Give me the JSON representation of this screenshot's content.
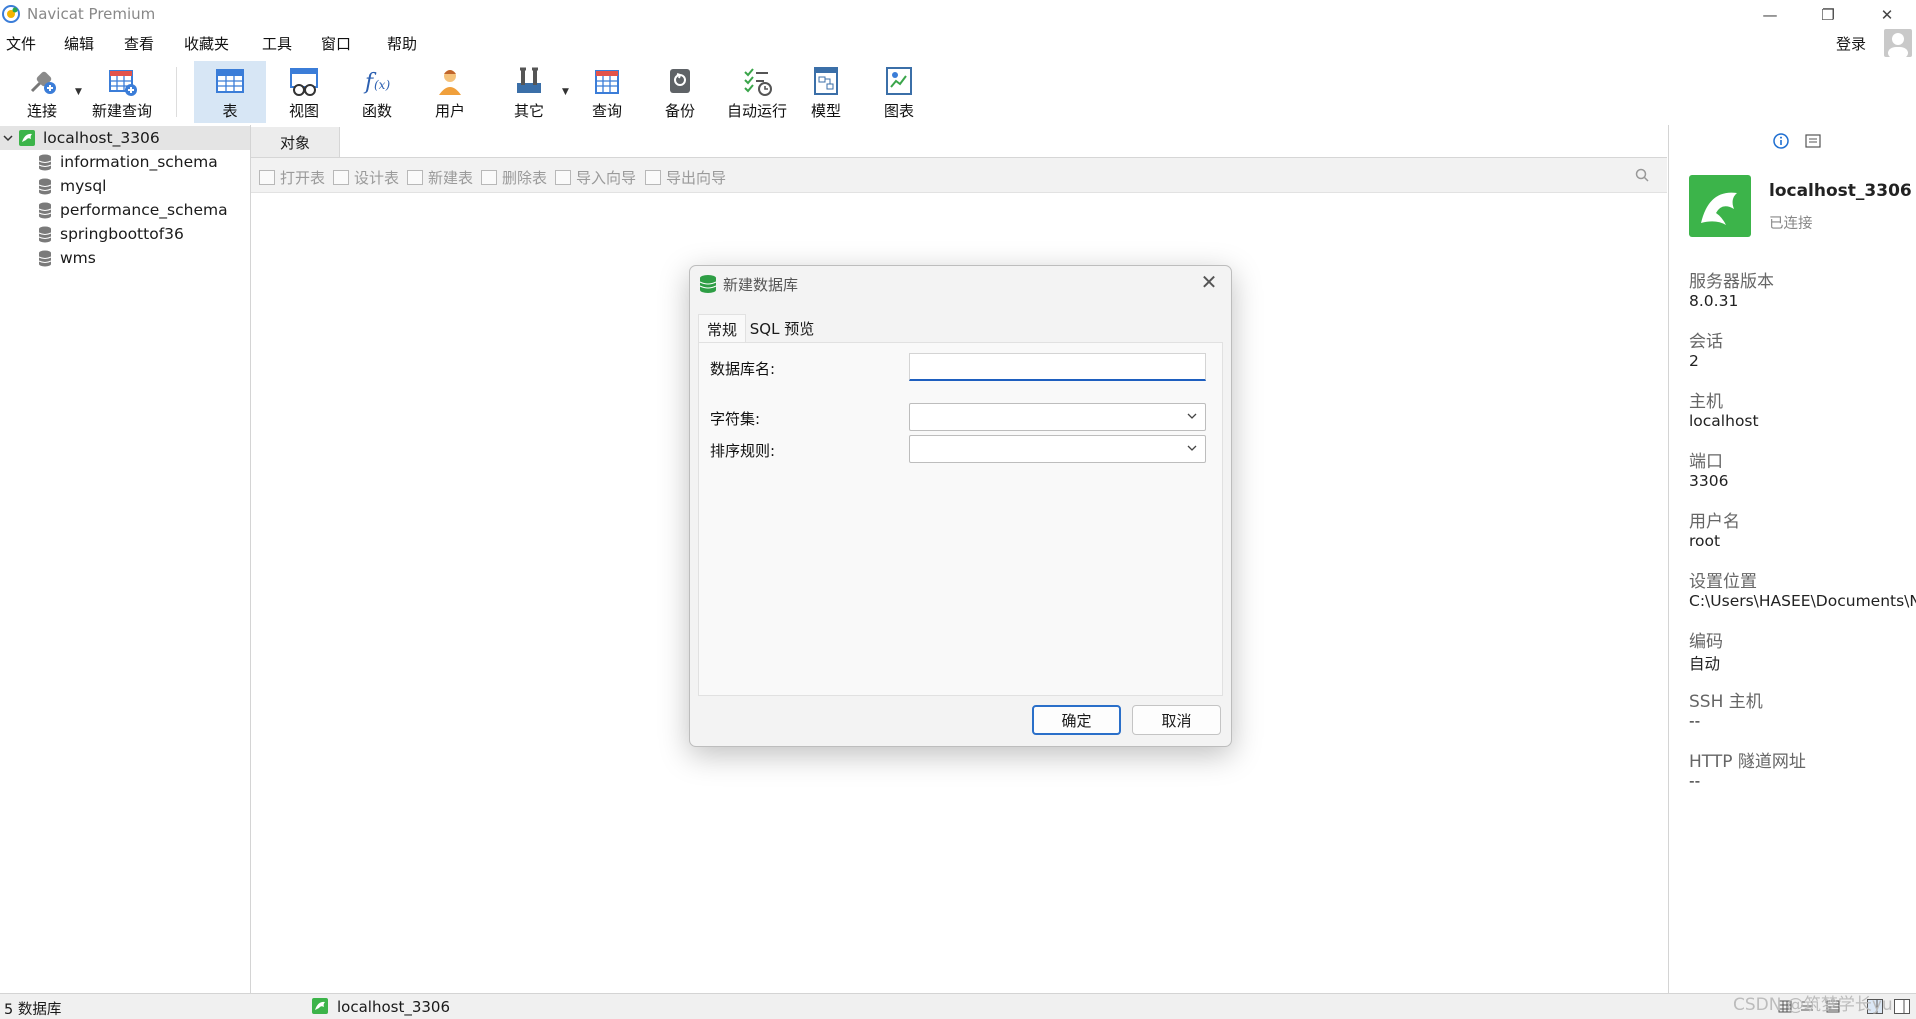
{
  "window": {
    "title": "Navicat Premium",
    "minimize": "—",
    "restore": "❐",
    "close": "✕"
  },
  "menu": {
    "items": [
      "文件",
      "编辑",
      "查看",
      "收藏夹",
      "工具",
      "窗口",
      "帮助"
    ],
    "login": "登录"
  },
  "toolbar": {
    "items": [
      {
        "label": "连接",
        "icon": "connect-plug-icon"
      },
      {
        "label": "新建查询",
        "icon": "new-query-icon"
      },
      {
        "label": "表",
        "icon": "table-icon"
      },
      {
        "label": "视图",
        "icon": "view-icon"
      },
      {
        "label": "函数",
        "icon": "function-icon"
      },
      {
        "label": "用户",
        "icon": "user-icon"
      },
      {
        "label": "其它",
        "icon": "tools-icon"
      },
      {
        "label": "查询",
        "icon": "query-icon"
      },
      {
        "label": "备份",
        "icon": "backup-icon"
      },
      {
        "label": "自动运行",
        "icon": "automation-icon"
      },
      {
        "label": "模型",
        "icon": "model-icon"
      },
      {
        "label": "图表",
        "icon": "chart-icon"
      }
    ],
    "active": "表"
  },
  "tree": {
    "connection": "localhost_3306",
    "databases": [
      "information_schema",
      "mysql",
      "performance_schema",
      "springboottof36",
      "wms"
    ]
  },
  "main": {
    "tab": "对象",
    "object_toolbar": [
      "打开表",
      "设计表",
      "新建表",
      "删除表",
      "导入向导",
      "导出向导"
    ]
  },
  "info_panel": {
    "name": "localhost_3306",
    "status": "已连接",
    "fields": [
      {
        "key": "服务器版本",
        "value": "8.0.31"
      },
      {
        "key": "会话",
        "value": "2"
      },
      {
        "key": "主机",
        "value": "localhost"
      },
      {
        "key": "端口",
        "value": "3306"
      },
      {
        "key": "用户名",
        "value": "root"
      },
      {
        "key": "设置位置",
        "value": "C:\\Users\\HASEE\\Documents\\N"
      },
      {
        "key": "编码",
        "value": "自动"
      },
      {
        "key": "SSH 主机",
        "value": "--"
      },
      {
        "key": "HTTP 隧道网址",
        "value": "--"
      }
    ]
  },
  "dialog": {
    "title": "新建数据库",
    "tabs": [
      "常规",
      "SQL 预览"
    ],
    "active_tab": "常规",
    "fields": {
      "db_name_label": "数据库名:",
      "db_name_value": "",
      "charset_label": "字符集:",
      "charset_value": "",
      "collation_label": "排序规则:",
      "collation_value": ""
    },
    "ok": "确定",
    "cancel": "取消"
  },
  "status": {
    "left": "5 数据库",
    "connection": "localhost_3306"
  },
  "watermark": "CSDN @筑梦学长yu",
  "colors": {
    "accent": "#2a6fc9",
    "mysql_green": "#3cb44a",
    "active_tool_bg": "#d7e6f5"
  }
}
